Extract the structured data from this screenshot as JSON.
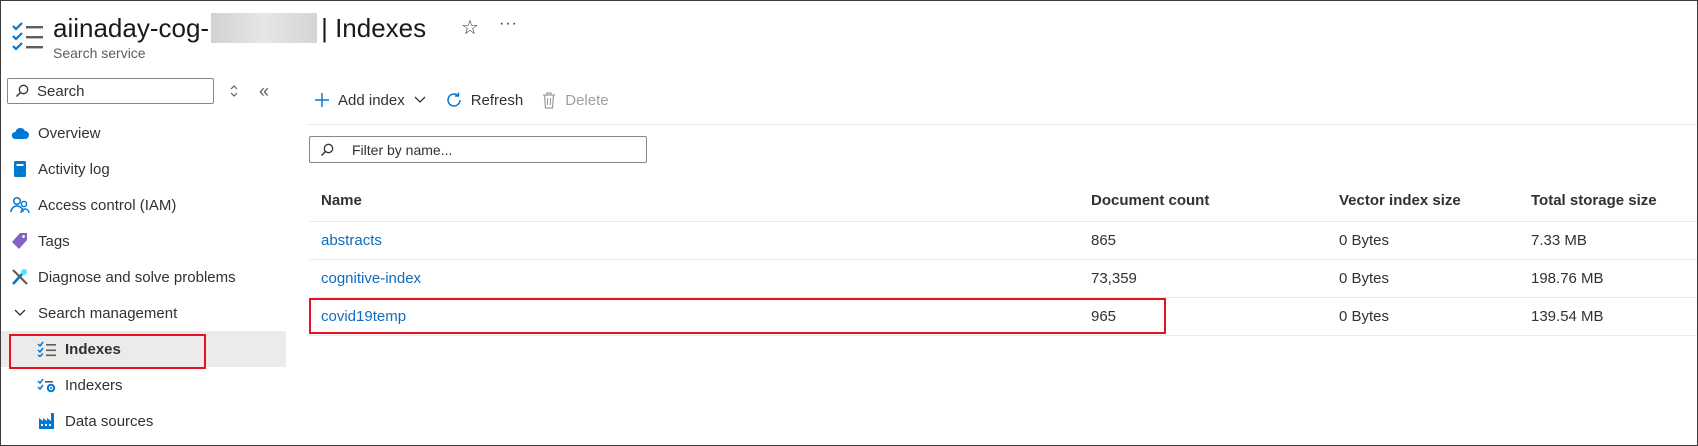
{
  "header": {
    "resource_name": "aiinaday-cog-",
    "page_title": "| Indexes",
    "subtitle": "Search service",
    "favorite_icon": "star-icon",
    "more_icon": "ellipsis-icon",
    "more_label": "···"
  },
  "sidebar": {
    "search_placeholder": "Search",
    "collapse_label": "«",
    "items": [
      {
        "label": "Overview",
        "icon": "cloud-icon"
      },
      {
        "label": "Activity log",
        "icon": "book-icon"
      },
      {
        "label": "Access control (IAM)",
        "icon": "people-icon"
      },
      {
        "label": "Tags",
        "icon": "tag-icon"
      },
      {
        "label": "Diagnose and solve problems",
        "icon": "wrench-icon"
      },
      {
        "label": "Search management",
        "icon": "chevron-down-icon"
      },
      {
        "label": "Indexes",
        "icon": "list-check-icon",
        "active": true
      },
      {
        "label": "Indexers",
        "icon": "indexer-icon"
      },
      {
        "label": "Data sources",
        "icon": "factory-icon"
      }
    ]
  },
  "toolbar": {
    "add_index": "Add index",
    "refresh": "Refresh",
    "delete": "Delete"
  },
  "filter": {
    "placeholder": "Filter by name..."
  },
  "table": {
    "columns": [
      "Name",
      "Document count",
      "Vector index size",
      "Total storage size"
    ],
    "rows": [
      [
        "abstracts",
        "865",
        "0 Bytes",
        "7.33 MB"
      ],
      [
        "cognitive-index",
        "73,359",
        "0 Bytes",
        "198.76 MB"
      ],
      [
        "covid19temp",
        "965",
        "0 Bytes",
        "139.54 MB"
      ]
    ]
  },
  "colors": {
    "link": "#0f6cbd",
    "highlight_box": "#e81123",
    "active_bg": "#edebe9"
  }
}
